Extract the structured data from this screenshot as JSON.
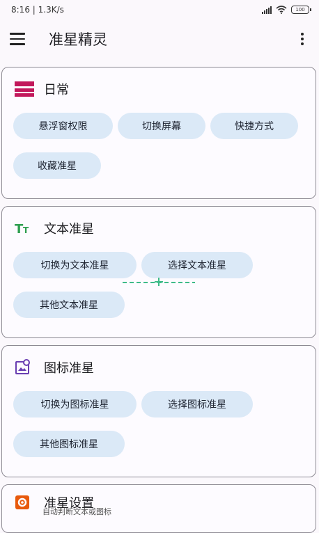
{
  "status_bar": {
    "time_speed": "8:16 | 1.3K/s",
    "battery": "100"
  },
  "app_bar": {
    "title": "准星精灵"
  },
  "sections": [
    {
      "title": "日常",
      "icon": "calendar-icon",
      "icon_color": "#c2185b",
      "chips": [
        "悬浮窗权限",
        "切换屏幕",
        "快捷方式",
        "收藏准星"
      ]
    },
    {
      "title": "文本准星",
      "icon": "text-format-icon",
      "icon_color": "#2e9e4f",
      "chips": [
        "切换为文本准星",
        "选择文本准星",
        "其他文本准星"
      ]
    },
    {
      "title": "图标准星",
      "icon": "image-icon",
      "icon_color": "#6a3fb2",
      "chips": [
        "切换为图标准星",
        "选择图标准星",
        "其他图标准星"
      ]
    },
    {
      "title": "准星设置",
      "icon": "settings-icon",
      "icon_color": "#e8590c",
      "subtitle": "自动判断文本或图标"
    }
  ],
  "colors": {
    "chip_background": "#dbe9f7",
    "card_border": "#8d8a93",
    "crosshair_guide": "#3dbb88"
  }
}
